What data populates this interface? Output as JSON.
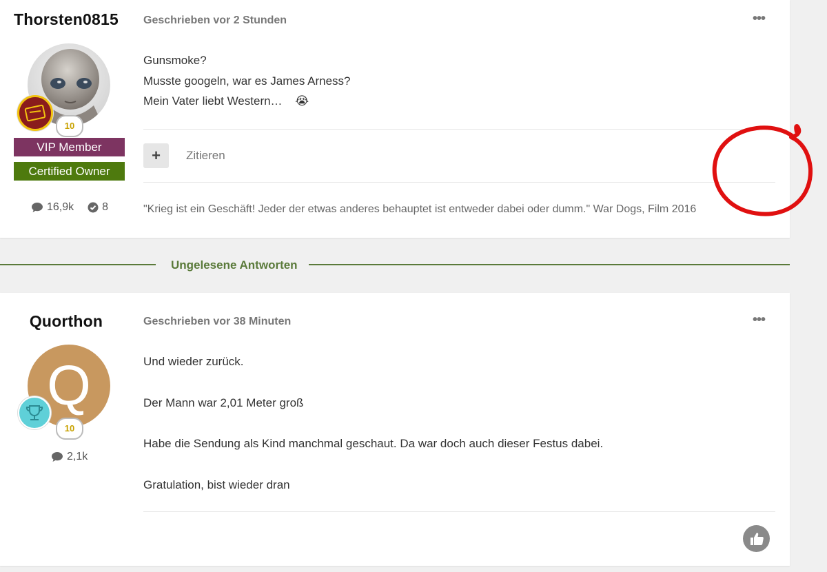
{
  "posts": [
    {
      "author": "Thorsten0815",
      "level": "10",
      "groups": [
        "VIP Member",
        "Certified Owner"
      ],
      "stats": {
        "posts": "16,9k",
        "solutions": "8"
      },
      "meta": "Geschrieben vor 2 Stunden",
      "menu_icon": "•••",
      "lines": [
        "Gunsmoke?",
        "Musste googeln, war es James Arness?",
        "Mein Vater liebt Western…"
      ],
      "emoji": "😭",
      "add_label": "+",
      "quote_label": "Zitieren",
      "signature": "\"Krieg ist ein Geschäft! Jeder der etwas anderes behauptet ist entweder dabei oder dumm.\" War Dogs, Film 2016"
    },
    {
      "author": "Quorthon",
      "avatar_letter": "Q",
      "level": "10",
      "stats": {
        "posts": "2,1k"
      },
      "meta": "Geschrieben vor 38 Minuten",
      "menu_icon": "•••",
      "lines": [
        "Und wieder zurück.",
        "Der Mann war 2,01 Meter groß",
        "Habe die Sendung als Kind manchmal geschaut. Da war doch auch dieser Festus dabei.",
        "Gratulation, bist wieder dran"
      ]
    }
  ],
  "divider": {
    "label": "Ungelesene Antworten"
  },
  "colors": {
    "vip": "#7d3461",
    "certified": "#4e7a0e",
    "accent_green": "#5a7a3a",
    "avatar_q": "#c8985f",
    "annotation": "#e01010"
  }
}
